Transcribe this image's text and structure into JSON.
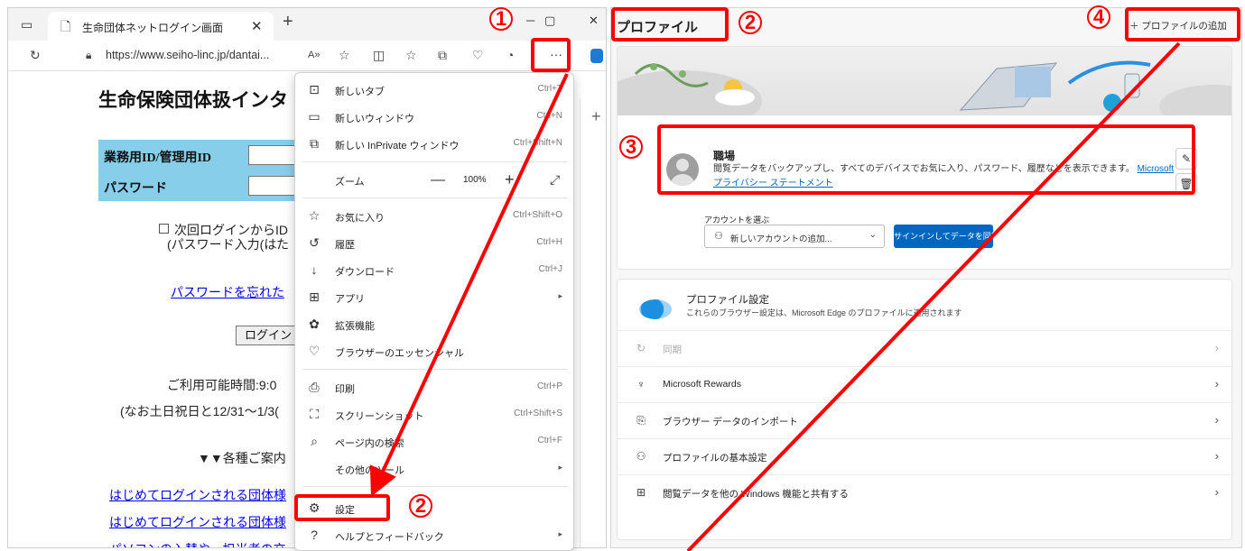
{
  "browser": {
    "tab_title": "生命団体ネットログイン画面",
    "url": "https://www.seiho-linc.jp/dantai...",
    "more_label": "···"
  },
  "page": {
    "title": "生命保険団体扱インタ",
    "login_id_label": "業務用ID/管理用ID",
    "password_label": "パスワード",
    "remember_line1": "次回ログインからID",
    "remember_line2": "(パスワード入力(はた",
    "forgot_link": "パスワードを忘れた",
    "login_button": "ログイン",
    "hours_text": "ご利用可能時間:9:0",
    "holiday_text": "(なお土日祝日と12/31～1/3(",
    "guide_heading": "▼▼各種ご案内",
    "link1": "はじめてログインされる団体様",
    "link2": "はじめてログインされる団体様",
    "link3": "パソコンの入替や、担当者の交"
  },
  "menu": {
    "items": [
      {
        "label": "新しいタブ",
        "shortcut": "Ctrl+T"
      },
      {
        "label": "新しいウィンドウ",
        "shortcut": "Ctrl+N"
      },
      {
        "label": "新しい InPrivate ウィンドウ",
        "shortcut": "Ctrl+Shift+N"
      },
      {
        "label": "ズーム",
        "shortcut": ""
      },
      {
        "label": "お気に入り",
        "shortcut": "Ctrl+Shift+O"
      },
      {
        "label": "履歴",
        "shortcut": "Ctrl+H"
      },
      {
        "label": "ダウンロード",
        "shortcut": "Ctrl+J"
      },
      {
        "label": "アプリ",
        "shortcut": ""
      },
      {
        "label": "拡張機能",
        "shortcut": ""
      },
      {
        "label": "ブラウザーのエッセンシャル",
        "shortcut": ""
      },
      {
        "label": "印刷",
        "shortcut": "Ctrl+P"
      },
      {
        "label": "スクリーンショット",
        "shortcut": "Ctrl+Shift+S"
      },
      {
        "label": "ページ内の検索",
        "shortcut": "Ctrl+F"
      },
      {
        "label": "その他のツール",
        "shortcut": ""
      },
      {
        "label": "設定",
        "shortcut": ""
      },
      {
        "label": "ヘルプとフィードバック",
        "shortcut": ""
      }
    ],
    "zoom_value": "100%"
  },
  "settings": {
    "title": "プロファイル",
    "add_profile": "＋ プロファイルの追加",
    "profile_name": "職場",
    "profile_desc": "閲覧データをバックアップし、すべてのデバイスでお気に入り、パスワード、履歴などを表示できます。",
    "profile_link": "Microsoft プライバシー ステートメント",
    "account_label": "アカウントを選ぶ",
    "account_select": "新しいアカウントの追加...",
    "sync_button": "サインインしてデータを同期",
    "profile_settings_title": "プロファイル設定",
    "profile_settings_sub": "これらのブラウザー設定は、Microsoft Edge のプロファイルに適用されます",
    "rows": [
      {
        "label": "同期"
      },
      {
        "label": "Microsoft Rewards"
      },
      {
        "label": "ブラウザー データのインポート"
      },
      {
        "label": "プロファイルの基本設定"
      },
      {
        "label": "閲覧データを他の Windows 機能と共有する"
      }
    ]
  },
  "annotations": {
    "n1": "1",
    "n2": "2",
    "n3": "3",
    "n4": "4",
    "color": "#ff0000"
  }
}
